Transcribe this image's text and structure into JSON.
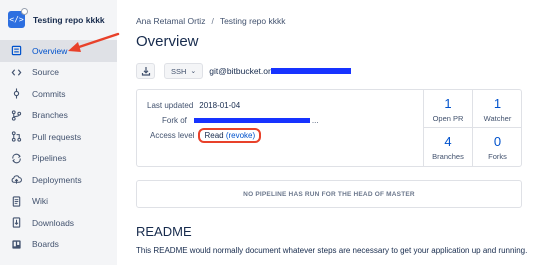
{
  "repo": {
    "name": "Testing repo kkkk",
    "avatar_glyph": "</>"
  },
  "sidebar": {
    "items": [
      {
        "label": "Overview",
        "icon": "overview-icon",
        "active": true
      },
      {
        "label": "Source",
        "icon": "code-icon"
      },
      {
        "label": "Commits",
        "icon": "commit-icon"
      },
      {
        "label": "Branches",
        "icon": "branch-icon"
      },
      {
        "label": "Pull requests",
        "icon": "pull-request-icon"
      },
      {
        "label": "Pipelines",
        "icon": "pipeline-icon"
      },
      {
        "label": "Deployments",
        "icon": "cloud-upload-icon"
      },
      {
        "label": "Wiki",
        "icon": "document-icon"
      },
      {
        "label": "Downloads",
        "icon": "download-page-icon"
      },
      {
        "label": "Boards",
        "icon": "board-icon"
      }
    ]
  },
  "breadcrumb": {
    "user": "Ana Retamal Ortiz",
    "sep": "/",
    "repo": "Testing repo kkkk"
  },
  "main": {
    "title": "Overview",
    "clone": {
      "protocol": "SSH",
      "url_prefix": "git@bitbucket.or"
    },
    "info": {
      "last_updated_label": "Last updated",
      "last_updated_value": "2018-01-04",
      "fork_label": "Fork of",
      "fork_ellipsis": "...",
      "access_label": "Access level",
      "access_value": "Read",
      "revoke_label": "(revoke)"
    },
    "stats": [
      {
        "value": "1",
        "label": "Open PR"
      },
      {
        "value": "1",
        "label": "Watcher"
      },
      {
        "value": "4",
        "label": "Branches"
      },
      {
        "value": "0",
        "label": "Forks"
      }
    ],
    "pipeline_notice": "NO PIPELINE HAS RUN FOR THE HEAD OF MASTER",
    "readme": {
      "title": "README",
      "text": "This README would normally document whatever steps are necessary to get your application up and running."
    }
  },
  "colors": {
    "accent": "#0052cc",
    "annotation": "#e8412a",
    "redaction": "#1733ff"
  }
}
